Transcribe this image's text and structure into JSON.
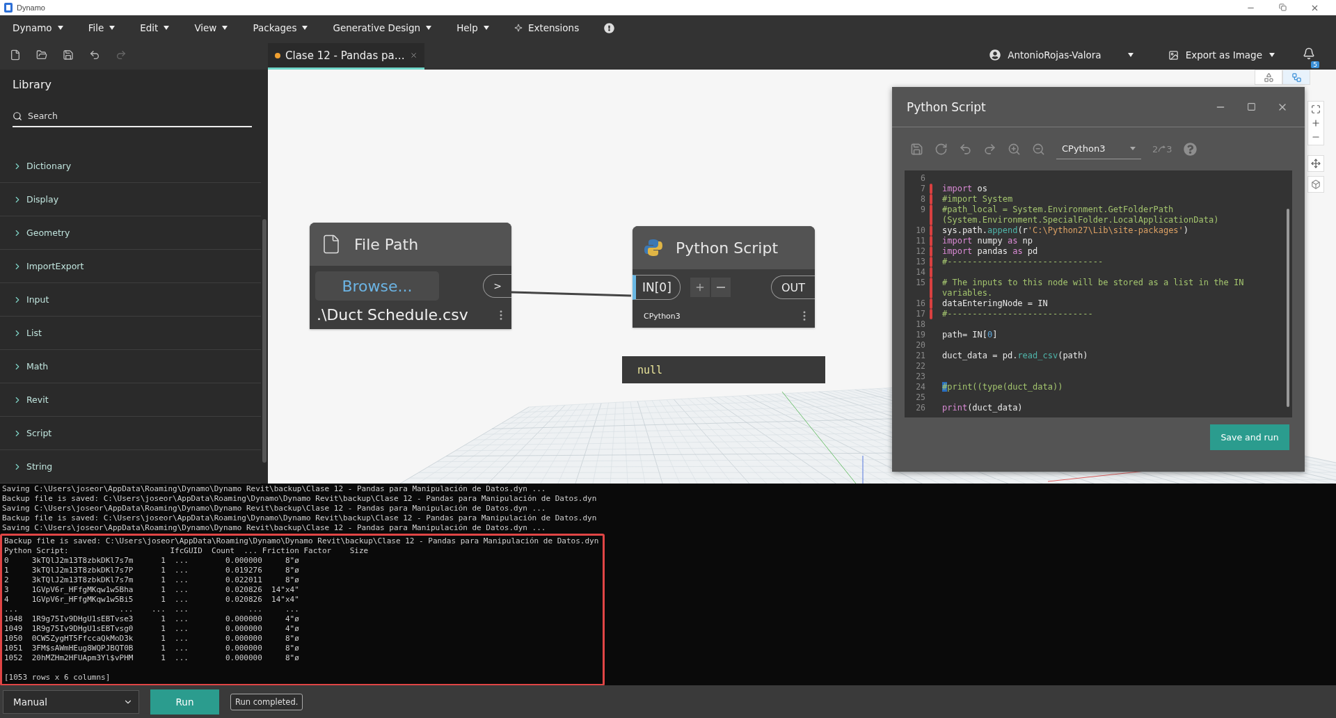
{
  "window": {
    "title": "Dynamo"
  },
  "menu": [
    {
      "label": "Dynamo",
      "kind": "dropdown"
    },
    {
      "label": "File",
      "kind": "dropdown"
    },
    {
      "label": "Edit",
      "kind": "dropdown"
    },
    {
      "label": "View",
      "kind": "dropdown"
    },
    {
      "label": "Packages",
      "kind": "dropdown"
    },
    {
      "label": "Generative Design",
      "kind": "dropdown"
    },
    {
      "label": "Help",
      "kind": "dropdown"
    },
    {
      "label": "Extensions",
      "kind": "extension"
    }
  ],
  "toolbar": [
    {
      "kind": "new",
      "disabled": false
    },
    {
      "kind": "open",
      "disabled": false
    },
    {
      "kind": "save",
      "disabled": false
    },
    {
      "kind": "undo",
      "disabled": false
    },
    {
      "kind": "redo",
      "disabled": true
    }
  ],
  "document_tab": {
    "title": "Clase 12 - Pandas pa…",
    "unsaved": true,
    "selected": true
  },
  "user": {
    "name": "AntonioRojas-Valora"
  },
  "export": {
    "label": "Export as Image"
  },
  "notifications": {
    "count": "5"
  },
  "view_modes": [
    {
      "kind": "geometry",
      "selected": false
    },
    {
      "kind": "graph",
      "selected": true
    }
  ],
  "library": {
    "title": "Library",
    "search": {
      "placeholder": "Search"
    },
    "items": [
      {
        "label": "Dictionary",
        "expanded": false
      },
      {
        "label": "Display",
        "expanded": false
      },
      {
        "label": "Geometry",
        "expanded": false
      },
      {
        "label": "ImportExport",
        "expanded": false
      },
      {
        "label": "Input",
        "expanded": false
      },
      {
        "label": "List",
        "expanded": false
      },
      {
        "label": "Math",
        "expanded": false
      },
      {
        "label": "Revit",
        "expanded": false
      },
      {
        "label": "Script",
        "expanded": false
      },
      {
        "label": "String",
        "expanded": false
      }
    ]
  },
  "file_path_node": {
    "title": "File Path",
    "button": "Browse...",
    "output_port": ">",
    "value": ".\\Duct Schedule.csv"
  },
  "python_node": {
    "title": "Python Script",
    "input_port": "IN[0]",
    "output_port": "OUT",
    "engine": "CPython3",
    "preview": "null"
  },
  "python_editor": {
    "title": "Python Script",
    "engine": "CPython3",
    "migrate": {
      "from": "2",
      "to": "3"
    },
    "save_button": "Save and run",
    "code_lines": [
      {
        "n": "6",
        "changed": false
      },
      {
        "n": "7",
        "changed": true,
        "tokens": [
          {
            "kind": "keyword",
            "text": "import"
          },
          {
            "kind": "plain",
            "text": " os"
          }
        ]
      },
      {
        "n": "8",
        "changed": true,
        "tokens": [
          {
            "kind": "comment",
            "text": "#import System"
          }
        ]
      },
      {
        "n": "9",
        "changed": true,
        "tokens": [
          {
            "kind": "comment",
            "text": "#path_local = System.Environment.GetFolderPath (System.Environment.SpecialFolder.LocalApplicationData)"
          }
        ]
      },
      {
        "n": "10",
        "changed": true,
        "tokens": [
          {
            "kind": "plain",
            "text": "sys.path."
          },
          {
            "kind": "function",
            "text": "append"
          },
          {
            "kind": "plain",
            "text": "(r"
          },
          {
            "kind": "string",
            "text": "'C:\\Python27\\Lib\\site-packages'"
          },
          {
            "kind": "plain",
            "text": ")"
          }
        ]
      },
      {
        "n": "11",
        "changed": true,
        "tokens": [
          {
            "kind": "keyword",
            "text": "import"
          },
          {
            "kind": "plain",
            "text": " numpy "
          },
          {
            "kind": "keyword",
            "text": "as"
          },
          {
            "kind": "plain",
            "text": " np"
          }
        ]
      },
      {
        "n": "12",
        "changed": true,
        "tokens": [
          {
            "kind": "keyword",
            "text": "import"
          },
          {
            "kind": "plain",
            "text": " pandas "
          },
          {
            "kind": "keyword",
            "text": "as"
          },
          {
            "kind": "plain",
            "text": " pd"
          }
        ]
      },
      {
        "n": "13",
        "changed": true,
        "tokens": [
          {
            "kind": "comment",
            "text": "#-------------------------------"
          }
        ]
      },
      {
        "n": "14",
        "changed": true
      },
      {
        "n": "15",
        "changed": true,
        "tokens": [
          {
            "kind": "comment",
            "text": "# The inputs to this node will be stored as a list in the IN variables."
          }
        ]
      },
      {
        "n": "16",
        "changed": true,
        "tokens": [
          {
            "kind": "plain",
            "text": "dataEnteringNode = IN"
          }
        ]
      },
      {
        "n": "17",
        "changed": true,
        "tokens": [
          {
            "kind": "comment",
            "text": "#-----------------------------"
          }
        ]
      },
      {
        "n": "18",
        "changed": false
      },
      {
        "n": "19",
        "changed": false,
        "tokens": [
          {
            "kind": "plain",
            "text": "path= IN["
          },
          {
            "kind": "number",
            "text": "0"
          },
          {
            "kind": "plain",
            "text": "]"
          }
        ]
      },
      {
        "n": "20",
        "changed": false
      },
      {
        "n": "21",
        "changed": false,
        "tokens": [
          {
            "kind": "plain",
            "text": "duct_data = pd."
          },
          {
            "kind": "function",
            "text": "read_csv"
          },
          {
            "kind": "plain",
            "text": "(path)"
          }
        ]
      },
      {
        "n": "22",
        "changed": false
      },
      {
        "n": "23",
        "changed": false
      },
      {
        "n": "24",
        "changed": false,
        "tokens": [
          {
            "kind": "cursor",
            "text": "#"
          },
          {
            "kind": "comment",
            "text": "print((type(duct_data))"
          }
        ]
      },
      {
        "n": "25",
        "changed": false
      },
      {
        "n": "26",
        "changed": false,
        "tokens": [
          {
            "kind": "keyword",
            "text": "print"
          },
          {
            "kind": "plain",
            "text": "(duct_data)"
          }
        ]
      }
    ]
  },
  "console": {
    "lines": [
      "Saving C:\\Users\\joseor\\AppData\\Roaming\\Dynamo\\Dynamo Revit\\backup\\Clase 12 - Pandas para Manipulación de Datos.dyn ...",
      "Backup file is saved: C:\\Users\\joseor\\AppData\\Roaming\\Dynamo\\Dynamo Revit\\backup\\Clase 12 - Pandas para Manipulación de Datos.dyn",
      "Saving C:\\Users\\joseor\\AppData\\Roaming\\Dynamo\\Dynamo Revit\\backup\\Clase 12 - Pandas para Manipulación de Datos.dyn ...",
      "Backup file is saved: C:\\Users\\joseor\\AppData\\Roaming\\Dynamo\\Dynamo Revit\\backup\\Clase 12 - Pandas para Manipulación de Datos.dyn",
      "Saving C:\\Users\\joseor\\AppData\\Roaming\\Dynamo\\Dynamo Revit\\backup\\Clase 12 - Pandas para Manipulación de Datos.dyn ..."
    ],
    "highlighted_block": {
      "lines": [
        "Backup file is saved: C:\\Users\\joseor\\AppData\\Roaming\\Dynamo\\Dynamo Revit\\backup\\Clase 12 - Pandas para Manipulación de Datos.dyn",
        "Python Script:                      IfcGUID  Count  ... Friction Factor    Size",
        "0     3kTQlJ2m13T8zbkDKl7s7m      1  ...        0.000000     8\"ø",
        "1     3kTQlJ2m13T8zbkDKl7s7P      1  ...        0.019276     8\"ø",
        "2     3kTQlJ2m13T8zbkDKl7s7m      1  ...        0.022011     8\"ø",
        "3     1GVpV6r_HFfgMKqw1w5Bha      1  ...        0.020826  14\"x4\"",
        "4     1GVpV6r_HFfgMKqw1w5Bi5      1  ...        0.020826  14\"x4\"",
        "...                      ...    ...  ...             ...     ...",
        "1048  1R9g75Iv9DHgU1sEBTvse3      1  ...        0.000000     4\"ø",
        "1049  1R9g75Iv9DHgU1sEBTvsg0      1  ...        0.000000     4\"ø",
        "1050  0CW5ZygHT5FfccaQkMoD3k      1  ...        0.000000     8\"ø",
        "1051  3FM$sAWmHEug8WQPJBQT0B      1  ...        0.000000     8\"ø",
        "1052  20hMZHm2HFUApm3Yl$vPHM      1  ...        0.000000     8\"ø"
      ],
      "summary": "[1053 rows x 6 columns]"
    }
  },
  "run_bar": {
    "mode": "Manual",
    "run_button": "Run",
    "status": "Run completed."
  }
}
